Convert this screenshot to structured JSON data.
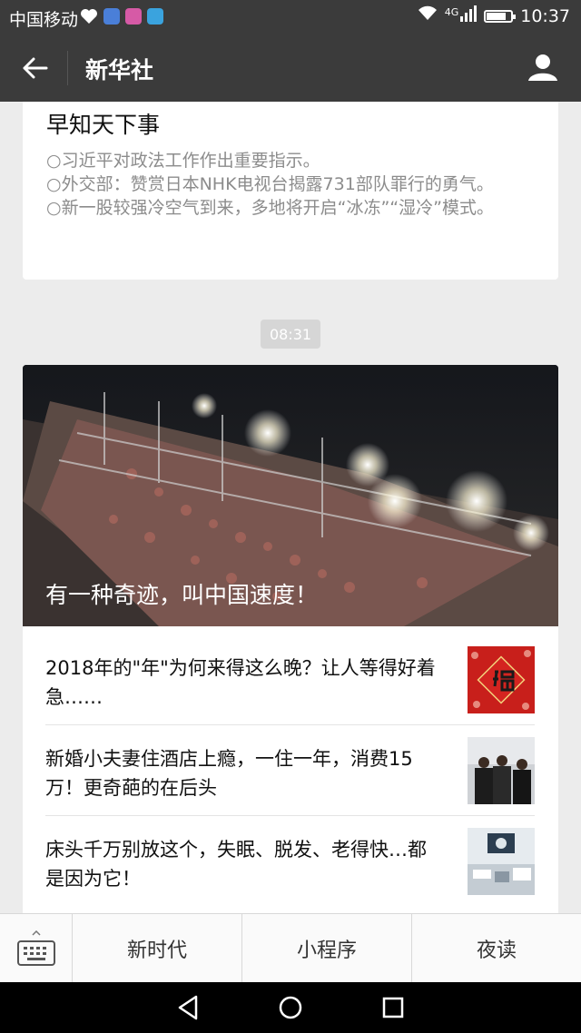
{
  "status_bar": {
    "carrier": "中国移动",
    "network": "4G",
    "time": "10:37",
    "battery_level": 0.8
  },
  "header": {
    "title": "新华社",
    "back_icon": "arrow-left-icon",
    "profile_icon": "person-icon"
  },
  "digest_card": {
    "title": "早知天下事",
    "items": [
      "习近平对政法工作作出重要指示。",
      "外交部：赞赏日本NHK电视台揭露731部队罪行的勇气。",
      "新一股较强冷空气到来，多地将开启“冰冻”“湿冷”模式。"
    ]
  },
  "timestamp": "08:31",
  "news_card": {
    "hero_caption": "有一种奇迹，叫中国速度！",
    "items": [
      {
        "title": "2018年的\"年\"为何来得这么晚？让人等得好着急……"
      },
      {
        "title": "新婚小夫妻住酒店上瘾，一住一年，消费15万！更奇葩的在后头"
      },
      {
        "title": "床头千万别放这个，失眠、脱发、老得快…都是因为它！"
      }
    ]
  },
  "bottom_menu": {
    "keyboard_icon": "keyboard-icon",
    "items": [
      "新时代",
      "小程序",
      "夜读"
    ]
  },
  "nav_bar": {
    "back_icon": "triangle-back-icon",
    "home_icon": "circle-home-icon",
    "recents_icon": "square-recents-icon"
  },
  "colors": {
    "bar_bg": "#3b3b3b",
    "page_bg": "#ececec",
    "card_bg": "#ffffff",
    "muted_text": "#8c8c8c"
  }
}
